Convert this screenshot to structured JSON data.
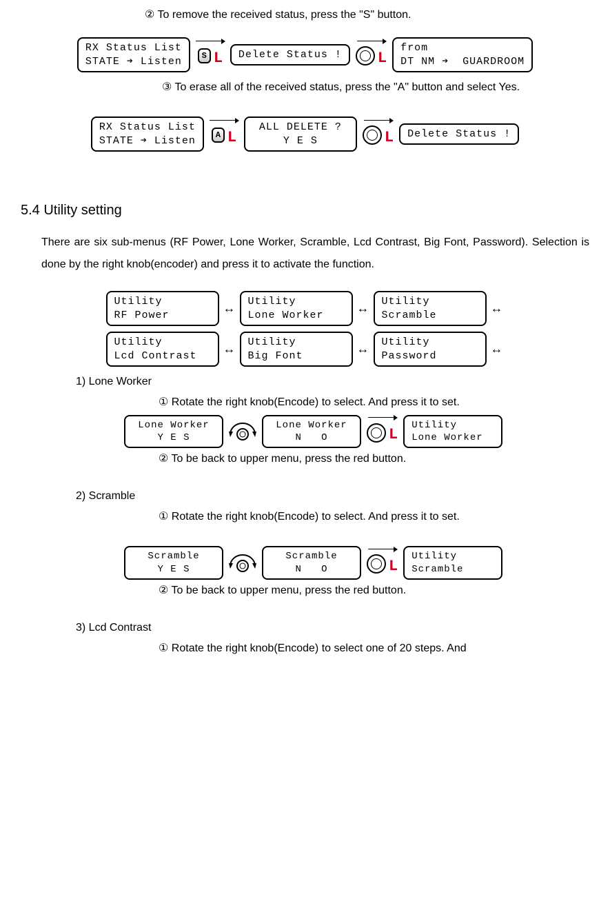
{
  "top": {
    "step2": "②  To remove the received status, press the \"S\" button.",
    "row1": {
      "lcd1_l1": "RX Status List",
      "lcd1_l2": "STATE ➔ Listen",
      "btn_label": "S",
      "lcd2_l1": "Delete Status !",
      "lcd3_l1": "from",
      "lcd3_l2": "DT NM ➔  GUARDROOM"
    },
    "step3": "③ To erase all of the received status, press the \"A\" button and select Yes.",
    "row2": {
      "lcd1_l1": "RX Status List",
      "lcd1_l2": "STATE ➔ Listen",
      "btn_label": "A",
      "lcd2_l1": "ALL DELETE ?",
      "lcd2_l2": "Y E S",
      "lcd3_l1": "Delete Status !"
    }
  },
  "section": {
    "title": "5.4 Utility setting",
    "intro": "There are six sub-menus (RF Power, Lone Worker, Scramble, Lcd Contrast, Big Font, Password). Selection is done by the right knob(encoder) and press it to activate the function.",
    "menus": [
      {
        "l1": "Utility",
        "l2": "RF Power"
      },
      {
        "l1": "Utility",
        "l2": "Lone Worker"
      },
      {
        "l1": "Utility",
        "l2": "Scramble"
      },
      {
        "l1": "Utility",
        "l2": "Lcd Contrast"
      },
      {
        "l1": "Utility",
        "l2": "Big Font"
      },
      {
        "l1": "Utility",
        "l2": "Password"
      }
    ]
  },
  "items": {
    "i1": {
      "heading": "1)    Lone Worker",
      "s1": "①    Rotate the right knob(Encode) to select. And press it to set.",
      "lcdA_l1": "Lone Worker",
      "lcdA_l2": "Y E S",
      "lcdB_l1": "Lone Worker",
      "lcdB_l2": "N   O",
      "lcdC_l1": "Utility",
      "lcdC_l2": "Lone Worker",
      "s2": "②    To be back to upper menu, press the red button."
    },
    "i2": {
      "heading": "2)    Scramble",
      "s1": "①    Rotate the right knob(Encode) to select. And press it to set.",
      "lcdA_l1": "Scramble",
      "lcdA_l2": "Y E S",
      "lcdB_l1": "Scramble",
      "lcdB_l2": "N   O",
      "lcdC_l1": "Utility",
      "lcdC_l2": "Scramble",
      "s2": "②    To be back to upper menu, press the red button."
    },
    "i3": {
      "heading": "3)    Lcd Contrast",
      "s1": "①   Rotate the right knob(Encode) to select one of 20 steps. And"
    }
  }
}
